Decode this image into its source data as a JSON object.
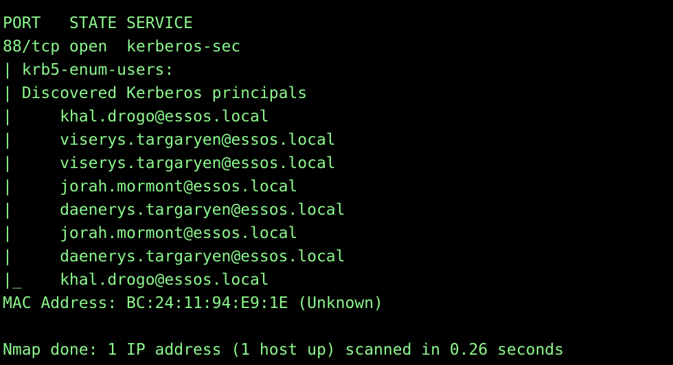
{
  "terminal": {
    "text_color": "#8cf78c",
    "background_color": "#000000",
    "lines": [
      "PORT   STATE SERVICE",
      "88/tcp open  kerberos-sec",
      "| krb5-enum-users:",
      "| Discovered Kerberos principals",
      "|     khal.drogo@essos.local",
      "|     viserys.targaryen@essos.local",
      "|     viserys.targaryen@essos.local",
      "|     jorah.mormont@essos.local",
      "|     daenerys.targaryen@essos.local",
      "|     jorah.mormont@essos.local",
      "|     daenerys.targaryen@essos.local",
      "|_    khal.drogo@essos.local",
      "MAC Address: BC:24:11:94:E9:1E (Unknown)",
      "",
      "Nmap done: 1 IP address (1 host up) scanned in 0.26 seconds"
    ]
  }
}
